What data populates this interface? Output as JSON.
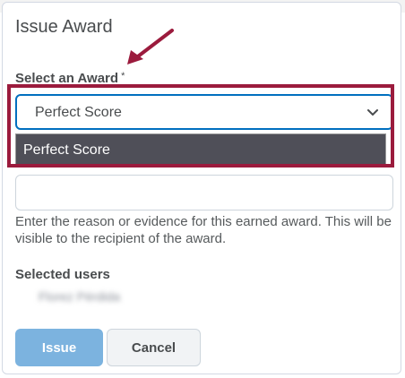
{
  "dialog": {
    "title": "Issue Award",
    "award_field": {
      "label": "Select an Award",
      "required_marker": "*",
      "selected_value": "Perfect Score",
      "options": [
        "Perfect Score"
      ]
    },
    "evidence_field": {
      "value": "",
      "help_text": "Enter the reason or evidence for this earned award. This will be visible to the recipient of the award."
    },
    "selected_users": {
      "label": "Selected users",
      "users": [
        "Florez Pérdida"
      ]
    },
    "buttons": {
      "issue_label": "Issue",
      "cancel_label": "Cancel"
    }
  },
  "colors": {
    "highlight": "#9b1b3d",
    "focus_border": "#006fbf",
    "dropdown_bg": "#4f4f58",
    "issue_button": "#7cb3df"
  }
}
